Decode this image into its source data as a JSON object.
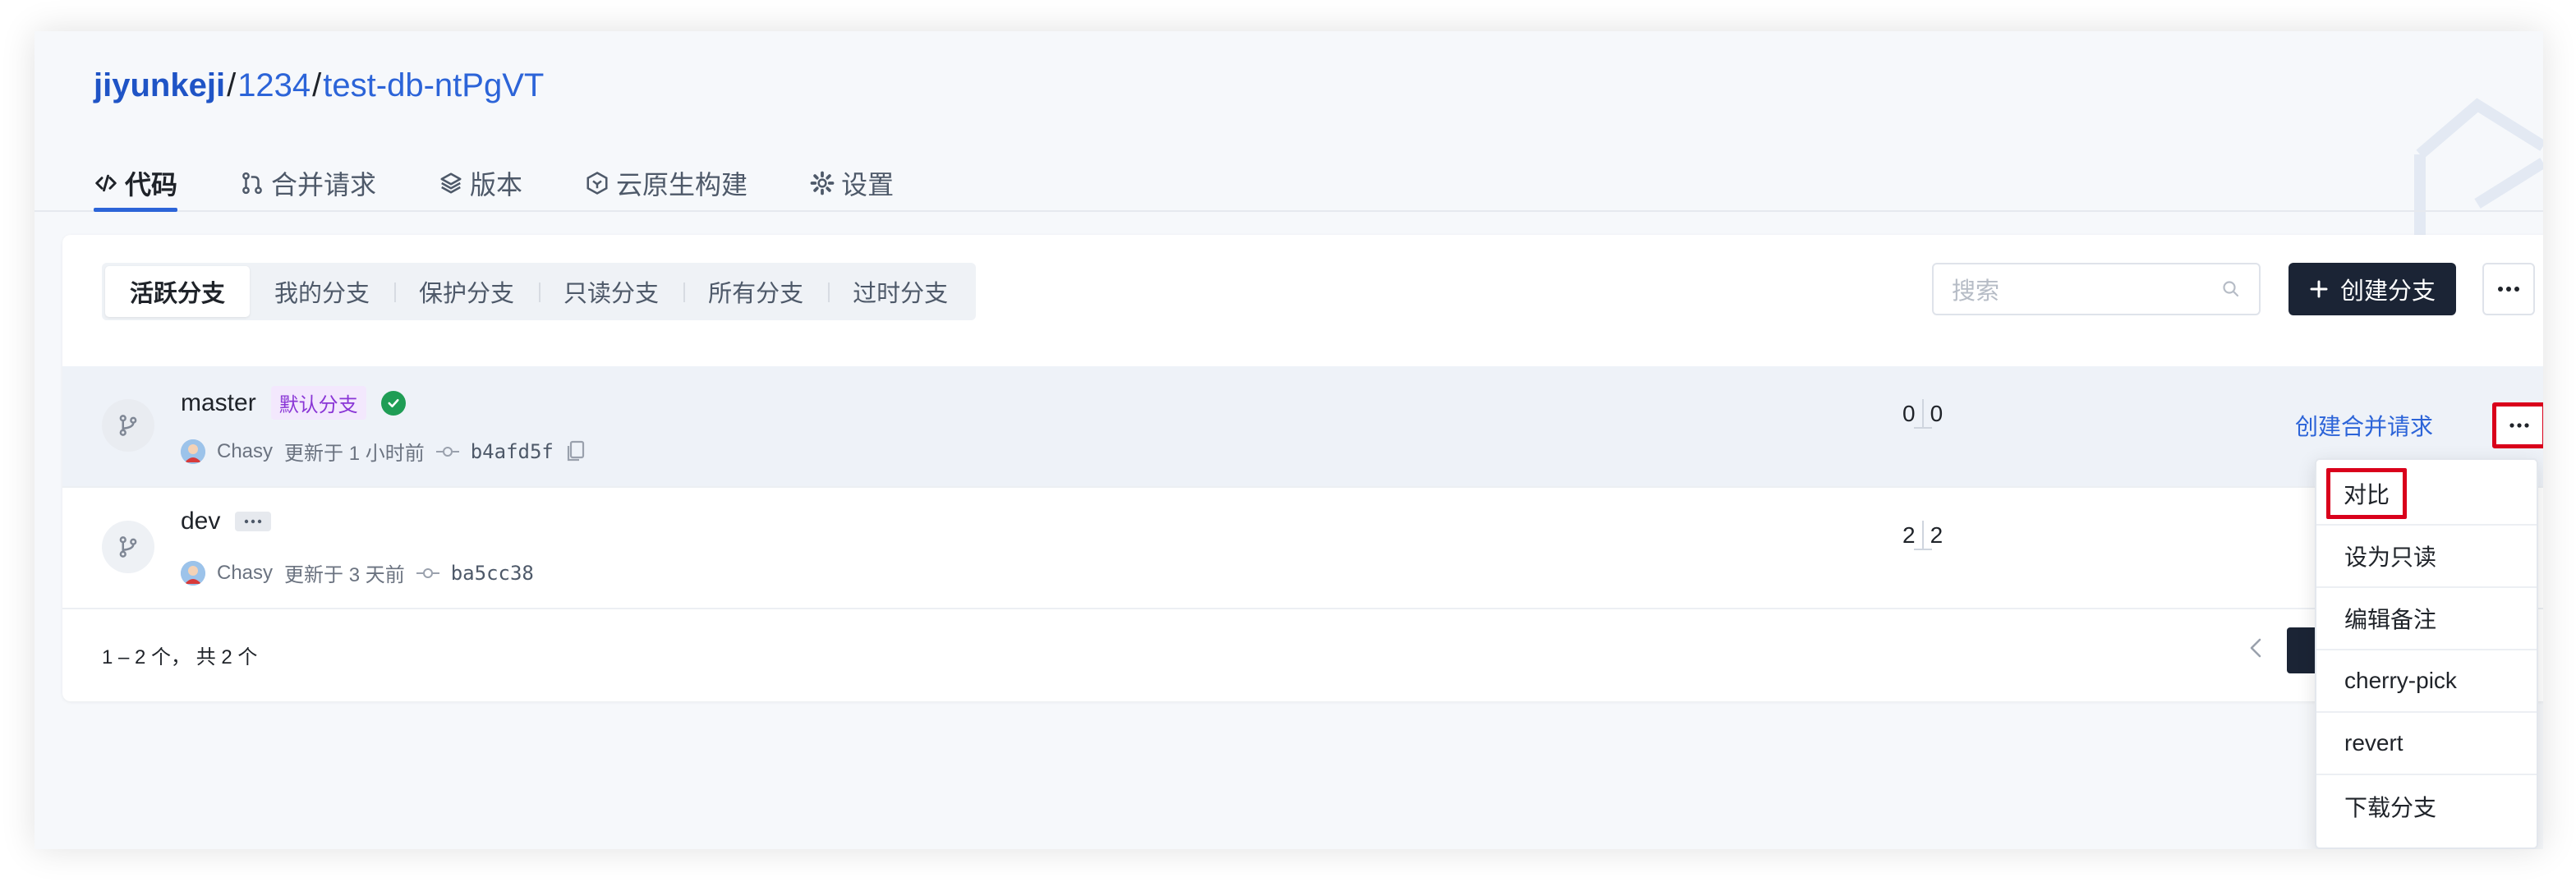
{
  "breadcrumb": {
    "owner": "jiyunkeji",
    "sep1": "/",
    "group": "1234",
    "sep2": "/",
    "repo": "test-db-ntPgVT"
  },
  "tabs": [
    {
      "label": "代码",
      "icon": "code-icon",
      "active": true
    },
    {
      "label": "合并请求",
      "icon": "merge-request-icon",
      "active": false
    },
    {
      "label": "版本",
      "icon": "layers-icon",
      "active": false
    },
    {
      "label": "云原生构建",
      "icon": "cloud-build-icon",
      "active": false
    },
    {
      "label": "设置",
      "icon": "gear-icon",
      "active": false
    }
  ],
  "filters": [
    {
      "label": "活跃分支",
      "active": true
    },
    {
      "label": "我的分支",
      "active": false
    },
    {
      "label": "保护分支",
      "active": false
    },
    {
      "label": "只读分支",
      "active": false
    },
    {
      "label": "所有分支",
      "active": false
    },
    {
      "label": "过时分支",
      "active": false
    }
  ],
  "search": {
    "placeholder": "搜索"
  },
  "create_button": {
    "label": "创建分支"
  },
  "branches": [
    {
      "name": "master",
      "badge": "默认分支",
      "author": "Chasy",
      "updated": "更新于 1 小时前",
      "commit": "b4afd5f",
      "behind": "0",
      "ahead": "0",
      "action": "创建合并请求"
    },
    {
      "name": "dev",
      "author": "Chasy",
      "updated": "更新于 3 天前",
      "commit": "ba5cc38",
      "behind": "2",
      "ahead": "2"
    }
  ],
  "footer": {
    "count": "1 – 2 个， 共 2 个"
  },
  "dropdown": [
    {
      "label": "对比"
    },
    {
      "label": "设为只读"
    },
    {
      "label": "编辑备注"
    },
    {
      "label": "cherry-pick"
    },
    {
      "label": "revert"
    },
    {
      "label": "下载分支"
    }
  ],
  "colors": {
    "accent": "#2c64d8",
    "dark_button": "#1b2435",
    "highlight_box": "#d9001b",
    "badge_purple": "#8a36d6",
    "success": "#1f9d55"
  }
}
